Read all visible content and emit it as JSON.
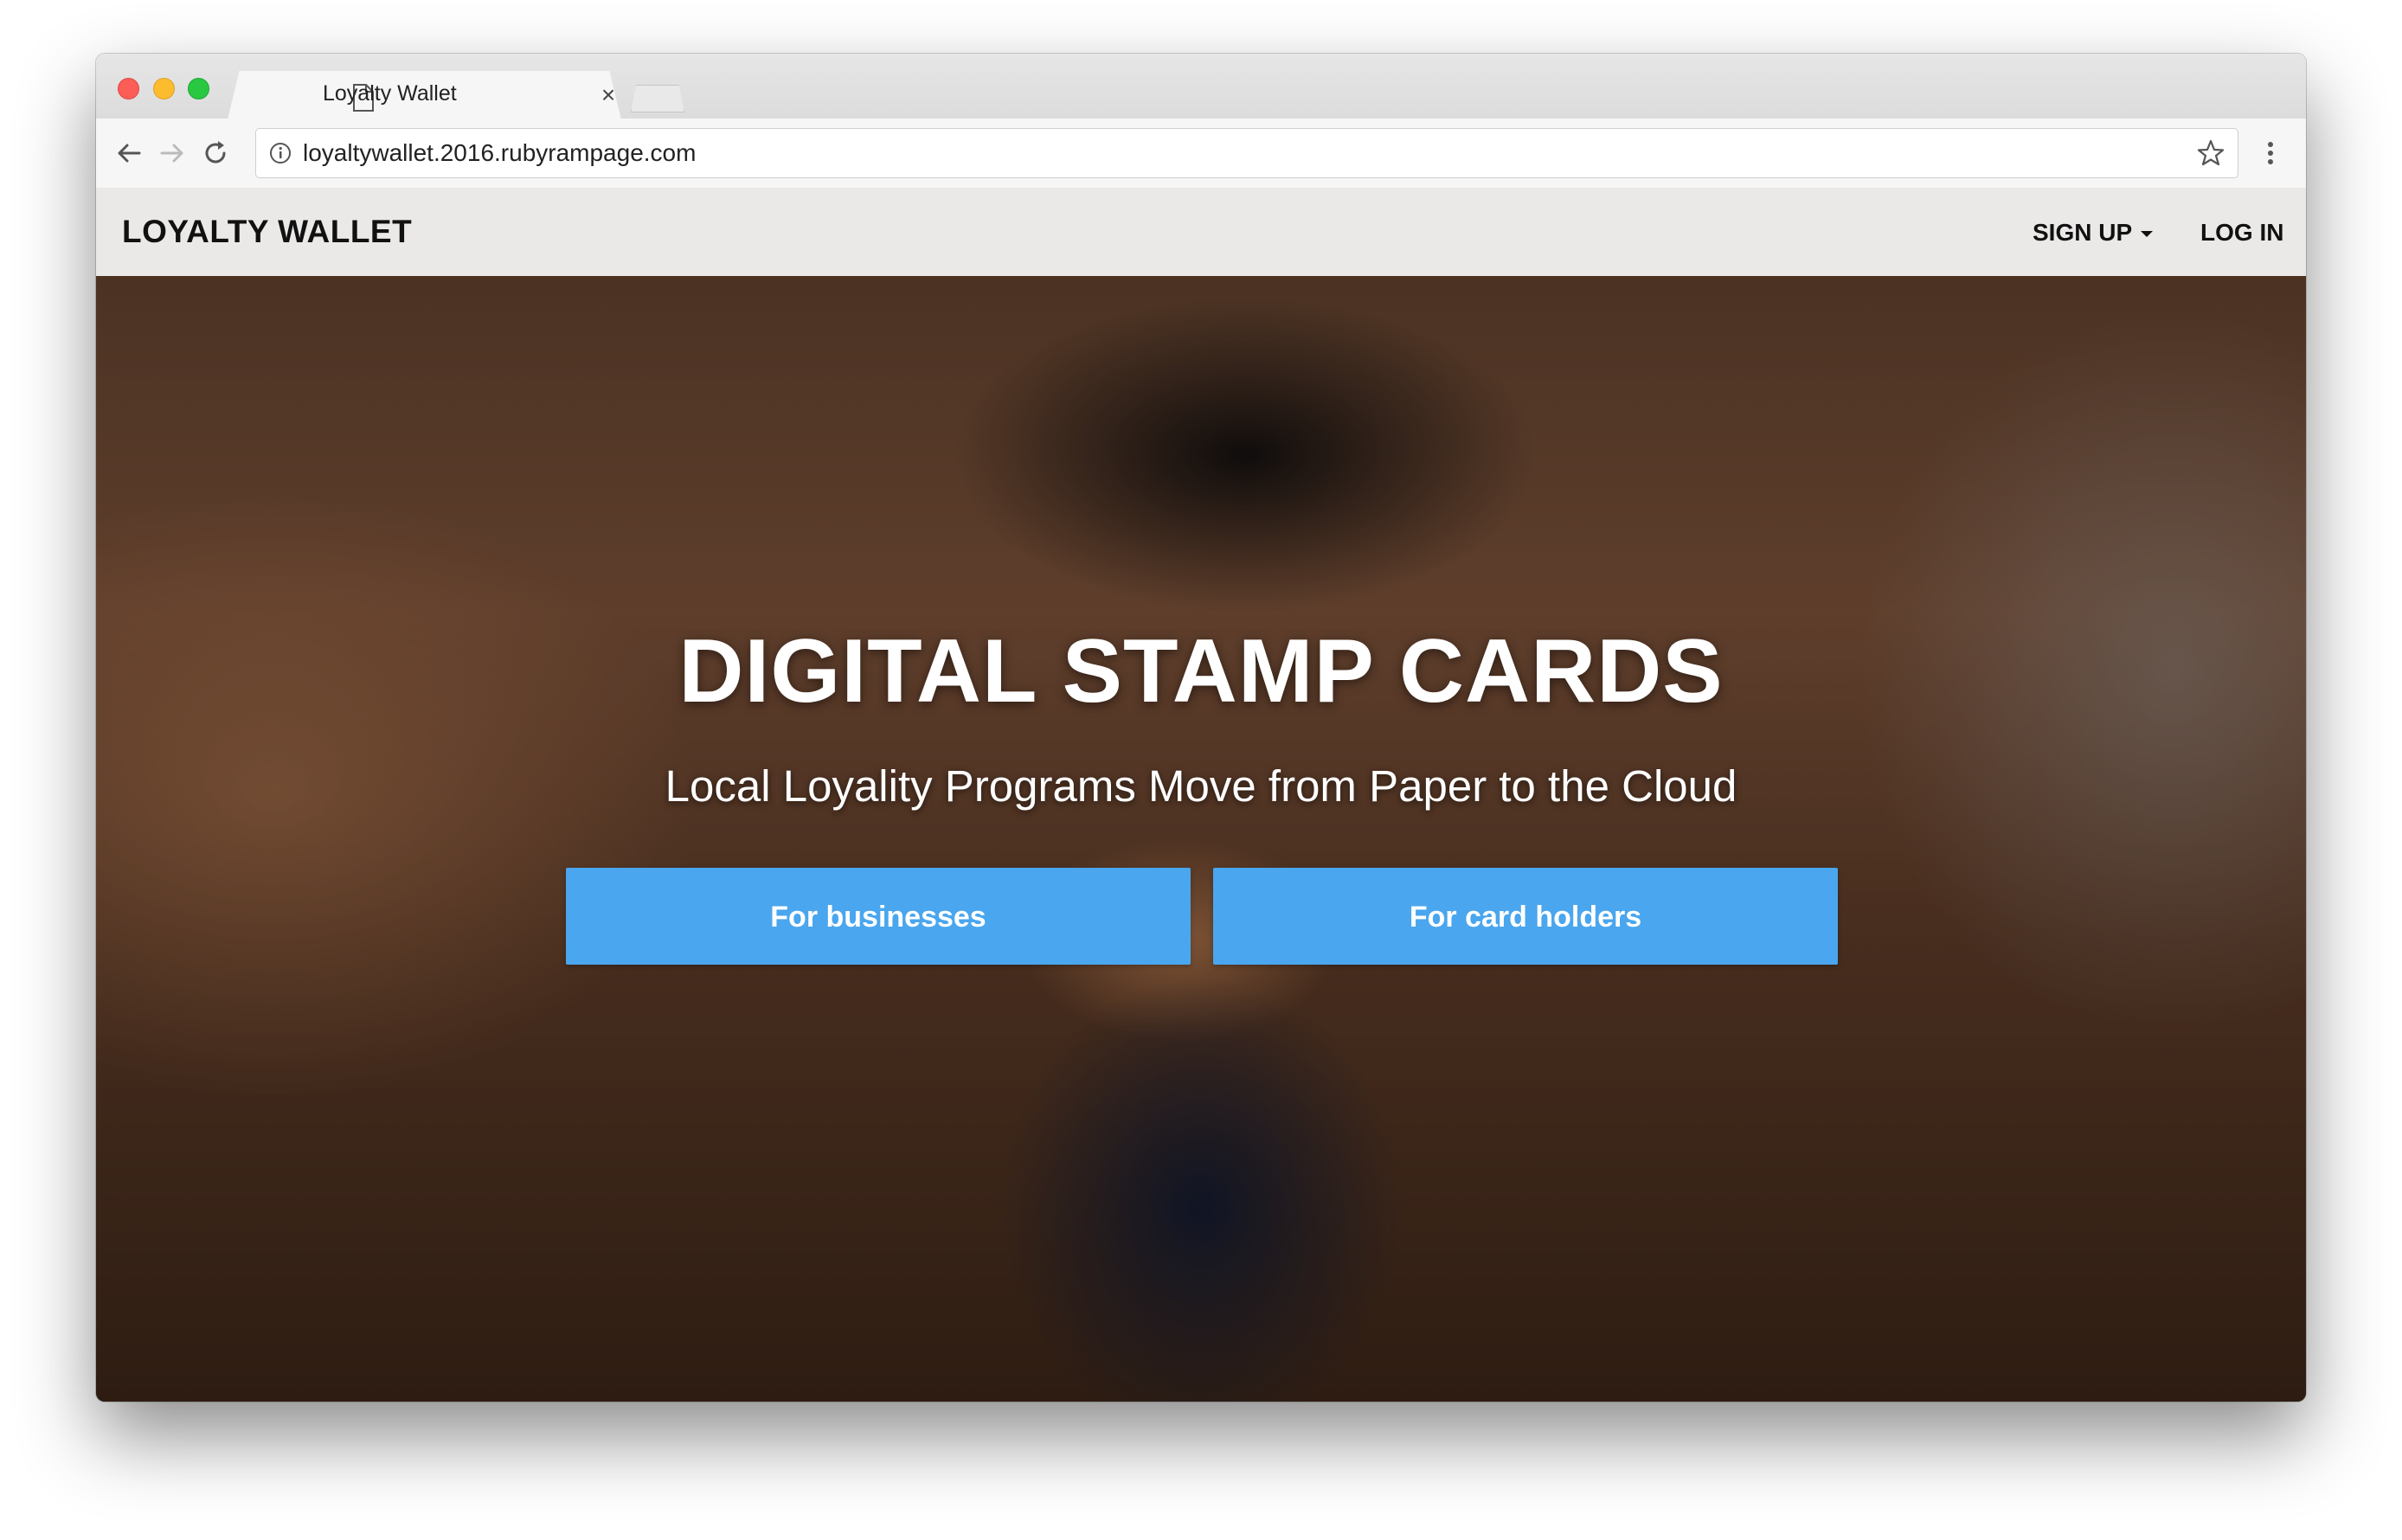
{
  "browser": {
    "tab_title": "Loyalty Wallet",
    "tab_close": "×",
    "url": "loyaltywallet.2016.rubyrampage.com"
  },
  "site": {
    "brand": "LOYALTY WALLET",
    "nav": {
      "signup": "SIGN UP",
      "login": "LOG IN"
    }
  },
  "hero": {
    "title": "DIGITAL STAMP CARDS",
    "subtitle": "Local Loyality Programs Move from Paper to the Cloud",
    "buttons": {
      "businesses": "For businesses",
      "card_holders": "For card holders"
    }
  },
  "colors": {
    "cta": "#4aa6ee",
    "nav_bg": "#f8f8f8"
  }
}
